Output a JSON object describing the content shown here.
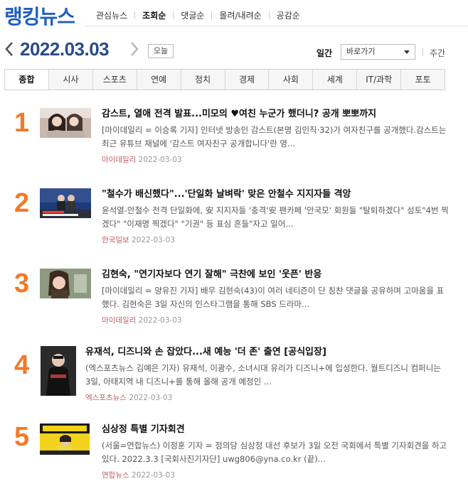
{
  "brand": {
    "logo": "랭킹뉴스"
  },
  "topnav": {
    "items": [
      "관심뉴스",
      "조회순",
      "댓글순",
      "올려/내려순",
      "공감순"
    ],
    "active_index": 1
  },
  "datebar": {
    "date": "2022.03.03",
    "today_label": "오늘",
    "daily_label": "일간",
    "select_value": "바로가기",
    "weekly_label": "주간"
  },
  "tabs": {
    "items": [
      "종합",
      "시사",
      "스포츠",
      "연예",
      "정치",
      "경제",
      "사회",
      "세계",
      "IT/과학",
      "포토"
    ],
    "active_index": 0
  },
  "articles": [
    {
      "rank": "1",
      "title": "감스트, 열애 전격 발표...미모의 ♥여친 누군가 했더니? 공개 뽀뽀까지",
      "summary": "[마이데일리 = 이승록 기자] 인터넷 방송인 감스트(본명 김인직·32)가 여자친구를 공개했다.감스트는 최근 유튜브 채널에 '감스트 여자친구 공개합니다'란 영...",
      "press": "마이데일리",
      "date": "2022-03-03"
    },
    {
      "rank": "2",
      "title": "\"철수가 배신했다\"...'단일화 날벼락' 맞은 안철수 지지자들 격앙",
      "summary": "윤석열-안철수 전격 단일화에, 安 지지자들 '충격'安 팬카페 '안국모' 회원들 \"탈퇴하겠다\" 성토\"4번 찍겠다\" \"이재명 찍겠다\" \"기권\" 등 표심 흔들\"자고 일어...",
      "press": "한국일보",
      "date": "2022-03-03"
    },
    {
      "rank": "3",
      "title": "김현숙, \"연기자보다 연기 잘해\" 극찬에 보인 '웃픈' 반응",
      "summary": "[마이데일리 = 양유진 기자] 배우 김현숙(43)이 여러 네티즌이 단 칭찬 댓글을 공유하며 고마움을 표했다. 김현숙은 3일 자신의 인스타그램을 통해 SBS 드라마...",
      "press": "마이데일리",
      "date": "2022-03-03"
    },
    {
      "rank": "4",
      "title": "유재석, 디즈니와 손 잡았다...새 예능 '더 존' 출연 [공식입장]",
      "summary": "(엑스포츠뉴스 김예은 기자) 유재석, 이광수, 소녀시대 유리가 디즈니+에 입성한다. 월트디즈니 컴퍼니는 3일, 아태지역 내 디즈니+를 통해 올해 공개 예정인 ...",
      "press": "엑스포츠뉴스",
      "date": "2022-03-03"
    },
    {
      "rank": "5",
      "title": "심상정 특별 기자회견",
      "summary": "(서울=연합뉴스) 이정훈 기자 = 정의당 심상정 대선 후보가 3일 오전 국회에서 특별 기자회견을 하고 있다. 2022.3.3 [국회사진기자단] uwg806@yna.co.kr (끝)...",
      "press": "연합뉴스",
      "date": "2022-03-03"
    }
  ],
  "colors": {
    "brand_blue": "#1f5fbf",
    "date_navy": "#2a4a8a",
    "rank_orange": "#f07a2a",
    "press_red": "#c06060"
  }
}
